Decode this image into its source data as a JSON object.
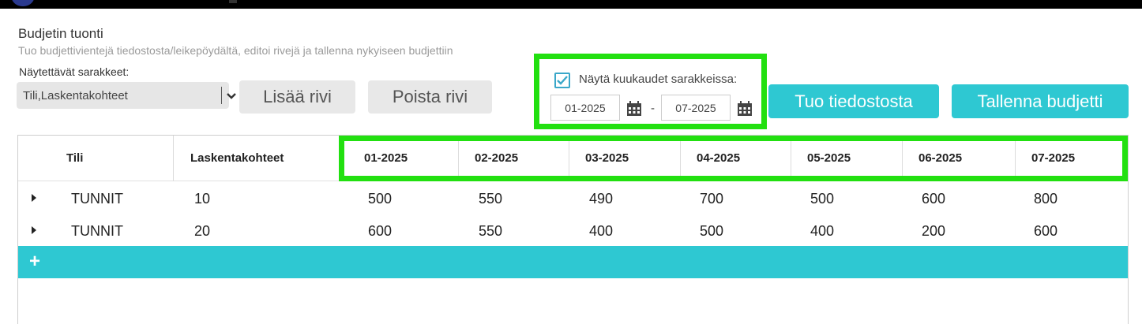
{
  "header": {
    "title": "Budjetin tuonti",
    "subtitle": "Tuo budjettivientejä tiedostosta/leikepöydältä, editoi rivejä ja tallenna nykyiseen budjettiin"
  },
  "columns_select": {
    "label": "Näytettävät sarakkeet:",
    "value": "Tili,Laskentakohteet"
  },
  "toolbar": {
    "add_row_label": "Lisää rivi",
    "delete_row_label": "Poista rivi",
    "import_label": "Tuo tiedostosta",
    "save_label": "Tallenna budjetti"
  },
  "month_columns": {
    "checked": true,
    "checkbox_label": "Näytä kuukaudet sarakkeissa:",
    "from": "01-2025",
    "separator": "-",
    "to": "07-2025"
  },
  "grid": {
    "headers": [
      "Tili",
      "Laskentakohteet",
      "01-2025",
      "02-2025",
      "03-2025",
      "04-2025",
      "05-2025",
      "06-2025",
      "07-2025"
    ],
    "rows": [
      [
        "TUNNIT",
        "10",
        "500",
        "550",
        "490",
        "700",
        "500",
        "600",
        "800"
      ],
      [
        "TUNNIT",
        "20",
        "600",
        "550",
        "400",
        "500",
        "400",
        "200",
        "600"
      ]
    ],
    "add_row_symbol": "+"
  },
  "colors": {
    "accent": "#2ec8d2",
    "highlight": "#22e010",
    "button_gray": "#e8e8e8"
  }
}
